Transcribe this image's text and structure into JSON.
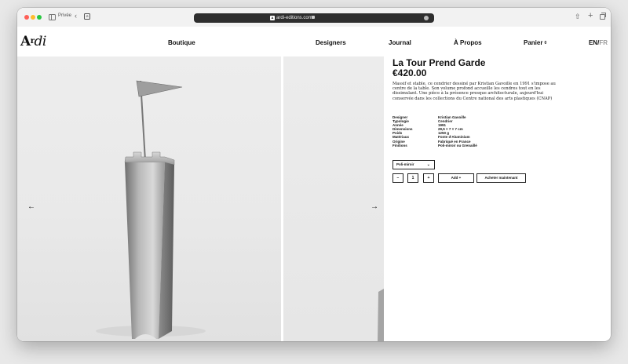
{
  "browser": {
    "private_label": "Privée",
    "url": "ardi-editions.com"
  },
  "site": {
    "logo": {
      "main": "A",
      "sup": "r",
      "rest": "di"
    },
    "nav": {
      "boutique": "Boutique",
      "designers": "Designers",
      "journal": "Journal",
      "apropos": "À Propos",
      "panier": "Panier",
      "cart_count": "0"
    },
    "lang": {
      "en": "EN",
      "sep": "/",
      "fr": "FR"
    }
  },
  "gallery": {
    "prev_arrow": "←",
    "next_arrow": "→"
  },
  "product": {
    "title": "La Tour Prend Garde",
    "price": "€420.00",
    "description": "Massif et stable, ce cendrier dessiné par Kristian Gavoille en 1991 s'impose au centre de la table. Son volume profond accueille les cendres tout en les dissimulant. Une pièce à la présence presque architecturale, aujourd'hui conservée dans les collections du Centre national des arts plastiques (CNAP)",
    "specs": [
      {
        "label": "Designer",
        "value": "Kristian Gavoille"
      },
      {
        "label": "Typologie",
        "value": "Cendrier"
      },
      {
        "label": "Année",
        "value": "1991"
      },
      {
        "label": "Dimensions",
        "value": "29,5 × 7 × 7 cm"
      },
      {
        "label": "Poids",
        "value": "1250 g"
      },
      {
        "label": "Matériaux",
        "value": "Fonte d'Aluminium"
      },
      {
        "label": "Origine",
        "value": "Fabriqué en France"
      },
      {
        "label": "Finitions",
        "value": "Poli-miroir ou Grenaillé"
      }
    ],
    "variant_selected": "Poli-miroir",
    "qty_minus": "−",
    "quantity": "1",
    "qty_plus": "+",
    "add_label": "Add +",
    "buy_label": "Acheter maintenant"
  }
}
